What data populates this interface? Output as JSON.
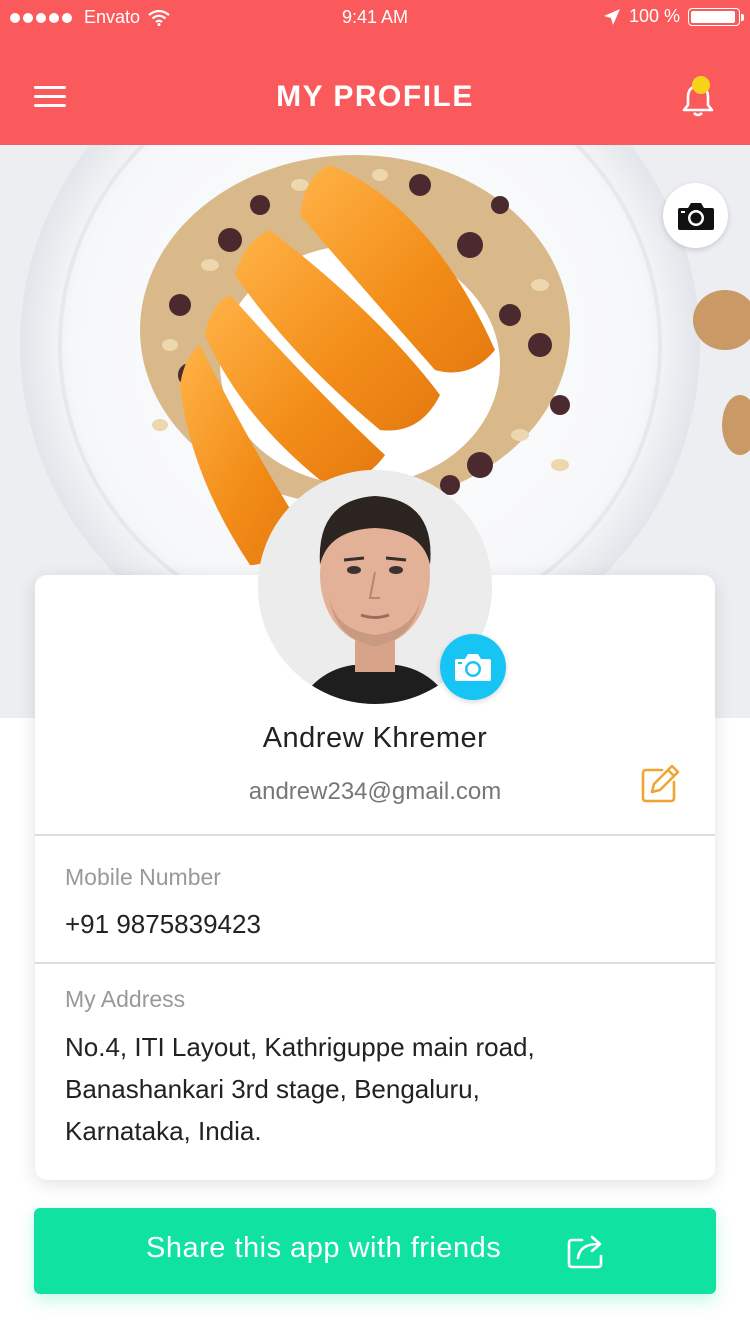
{
  "status_bar": {
    "carrier": "Envato",
    "time": "9:41 AM",
    "battery": "100 %"
  },
  "header": {
    "title": "MY PROFILE"
  },
  "profile": {
    "name": "Andrew Khremer",
    "email": "andrew234@gmail.com"
  },
  "fields": {
    "mobile_label": "Mobile Number",
    "mobile_value": "+91 9875839423",
    "address_label": "My Address",
    "address_lines": [
      "No.4, ITI Layout, Kathriguppe main road,",
      "Banashankari 3rd stage, Bengaluru,",
      "Karnataka, India."
    ]
  },
  "share": {
    "label": "Share this app with friends"
  },
  "colors": {
    "header": "#fb5a5c",
    "notification_dot": "#f7d21b",
    "camera_accent": "#17c5f5",
    "edit_icon": "#f0a531",
    "share_button": "#10e2a2"
  },
  "icons": {
    "menu": "hamburger-icon",
    "notifications": "bell-icon",
    "cover_camera": "camera-icon",
    "avatar_camera": "camera-icon",
    "edit": "edit-icon",
    "share": "share-icon"
  }
}
